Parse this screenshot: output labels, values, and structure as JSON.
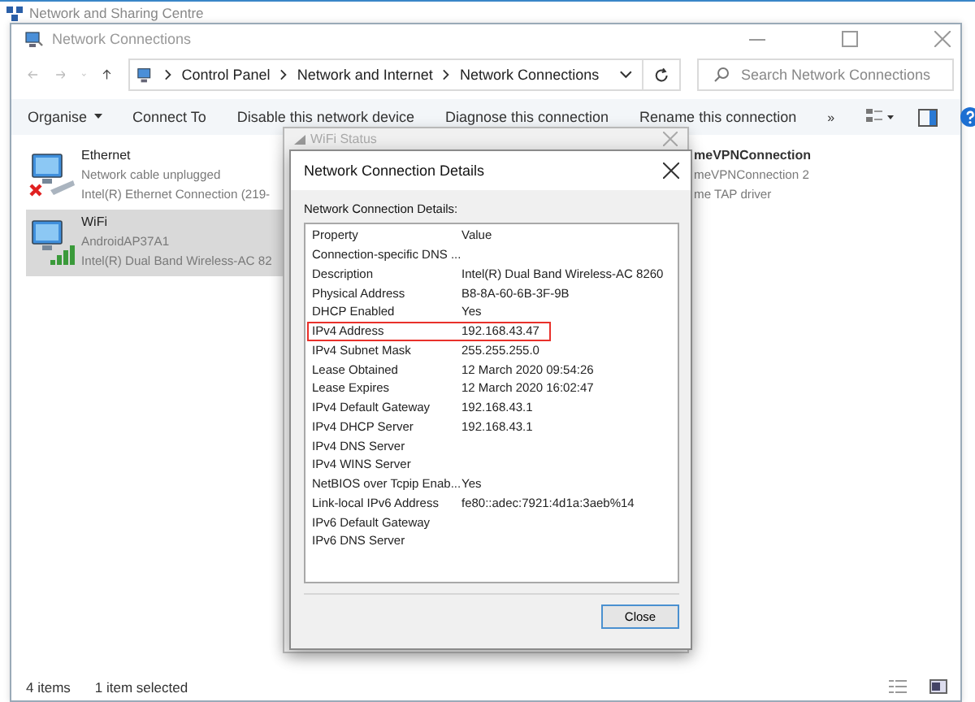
{
  "background_window": {
    "title": "Network and Sharing Centre"
  },
  "window": {
    "title": "Network Connections"
  },
  "address_bar": {
    "path": [
      "Control Panel",
      "Network and Internet",
      "Network Connections"
    ]
  },
  "search": {
    "placeholder": "Search Network Connections"
  },
  "toolbar": [
    {
      "label": "Organise",
      "kind": "menu"
    },
    {
      "label": "Connect To",
      "kind": "button"
    },
    {
      "label": "Disable this network device",
      "kind": "button"
    },
    {
      "label": "Diagnose this connection",
      "kind": "button"
    },
    {
      "label": "Rename this connection",
      "kind": "button"
    },
    {
      "label": "»",
      "kind": "overflow"
    }
  ],
  "connections": [
    {
      "name": "Ethernet",
      "status": "Network cable unplugged",
      "device": "Intel(R) Ethernet Connection (219-",
      "kind": "ethernet",
      "selected": false
    },
    {
      "name": "WiFi",
      "status": "AndroidAP37A1",
      "device": "Intel(R) Dual Band Wireless-AC 82",
      "kind": "wifi",
      "selected": true
    },
    {
      "name": "meVPNConnection",
      "status": "meVPNConnection 2",
      "device": "me TAP driver",
      "kind": "vpn",
      "selected": false
    }
  ],
  "status_bar": {
    "count": "4 items",
    "selection": "1 item selected"
  },
  "wifi_status_dialog": {
    "title": "WiFi Status"
  },
  "details_dialog": {
    "title": "Network Connection Details",
    "label": "Network Connection Details:",
    "columns": [
      "Property",
      "Value"
    ],
    "rows": [
      {
        "property": "Connection-specific DNS ...",
        "highlighted": false
      },
      {
        "property": "Description",
        "value": "Intel(R) Dual Band Wireless-AC 8260",
        "highlighted": false
      },
      {
        "property": "Physical Address",
        "value": "B8-8A-60-6B-3F-9B",
        "highlighted": false
      },
      {
        "property": "DHCP Enabled",
        "value": "Yes",
        "highlighted": false
      },
      {
        "property": "IPv4 Address",
        "value": "192.168.43.47",
        "highlighted": true
      },
      {
        "property": "IPv4 Subnet Mask",
        "value": "255.255.255.0",
        "highlighted": false
      },
      {
        "property": "Lease Obtained",
        "value": "12 March 2020 09:54:26",
        "highlighted": false
      },
      {
        "property": "Lease Expires",
        "value": "12 March 2020 16:02:47",
        "highlighted": false
      },
      {
        "property": "IPv4 Default Gateway",
        "value": "192.168.43.1",
        "highlighted": false
      },
      {
        "property": "IPv4 DHCP Server",
        "value": "192.168.43.1",
        "highlighted": false
      },
      {
        "property": "IPv4 DNS Server",
        "highlighted": false
      },
      {
        "property": "IPv4 WINS Server",
        "highlighted": false
      },
      {
        "property": "NetBIOS over Tcpip Enab...",
        "value": "Yes",
        "highlighted": false
      },
      {
        "property": "Link-local IPv6 Address",
        "value": "fe80::adec:7921:4d1a:3aeb%14",
        "highlighted": false
      },
      {
        "property": "IPv6 Default Gateway",
        "highlighted": false
      },
      {
        "property": "IPv6 DNS Server",
        "highlighted": false
      }
    ],
    "close_button": "Close"
  }
}
